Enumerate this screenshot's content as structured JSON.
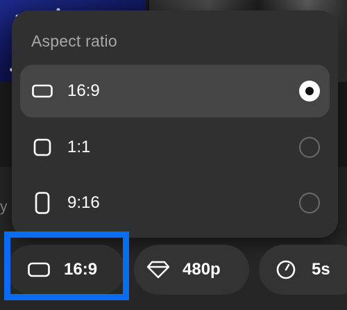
{
  "dropdown": {
    "title": "Aspect ratio",
    "options": [
      {
        "label": "16:9",
        "icon": "landscape-rect-icon",
        "selected": true
      },
      {
        "label": "1:1",
        "icon": "square-icon",
        "selected": false
      },
      {
        "label": "9:16",
        "icon": "portrait-rect-icon",
        "selected": false
      }
    ]
  },
  "toolbar": {
    "aspect_label": "16:9",
    "aspect_icon": "landscape-rect-icon",
    "quality_label": "480p",
    "quality_icon": "diamond-icon",
    "duration_label": "5s",
    "duration_icon": "timer-icon"
  },
  "background": {
    "partial_text": "y"
  },
  "colors": {
    "highlight": "#0a6cf0",
    "panel": "#303030",
    "selected_row": "#454545"
  }
}
